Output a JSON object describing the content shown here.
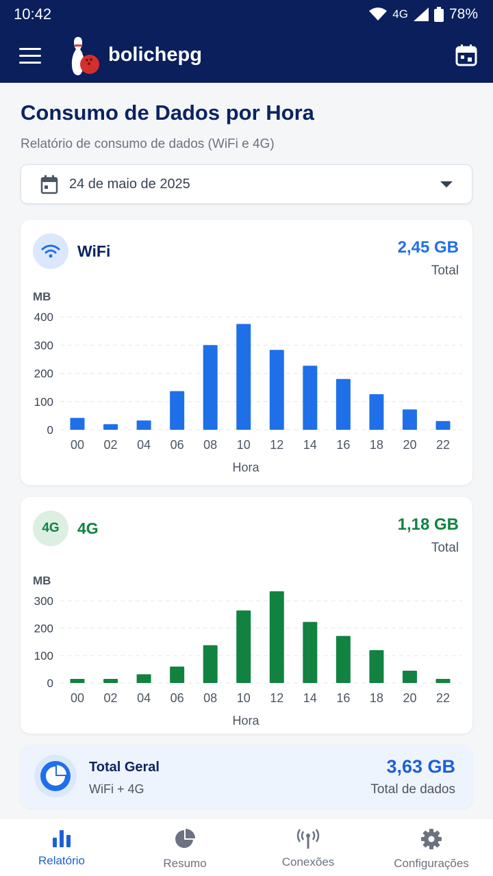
{
  "status_bar": {
    "time": "10:42",
    "network": "4G",
    "battery": "78%"
  },
  "app_bar": {
    "title": "bolichepg",
    "menu_icon": "menu-icon",
    "action_icon": "calendar-icon"
  },
  "page": {
    "title": "Consumo de Dados por Hora",
    "subtitle": "Relatório de consumo de dados (WiFi e 4G)",
    "date_select": {
      "value": "24 de maio de 2025",
      "icon": "calendar-icon"
    }
  },
  "wifi_card": {
    "name": "WiFi",
    "total": "2,45 GB",
    "total_label": "Total",
    "badge_icon": "wifi-icon",
    "color": "#1f6fe8"
  },
  "g4_card": {
    "name": "4G",
    "badge": "4G",
    "total": "1,18 GB",
    "total_label": "Total",
    "color": "#128241"
  },
  "summary": {
    "title": "Total Geral",
    "subtitle": "WiFi + 4G",
    "total": "3,63 GB",
    "total_label": "Total de dados",
    "icon": "pie-chart-icon"
  },
  "bottom_nav": [
    {
      "label": "Relatório",
      "icon": "bar-chart-icon",
      "active": true
    },
    {
      "label": "Resumo",
      "icon": "pie-chart-icon",
      "active": false
    },
    {
      "label": "Conexões",
      "icon": "antenna-icon",
      "active": false
    },
    {
      "label": "Configurações",
      "icon": "gear-icon",
      "active": false
    }
  ],
  "chart_data": [
    {
      "type": "bar",
      "title": "",
      "xlabel": "Hora",
      "ylabel": "MB",
      "categories": [
        "00",
        "02",
        "04",
        "06",
        "08",
        "10",
        "12",
        "14",
        "16",
        "18",
        "20",
        "22"
      ],
      "series": [
        {
          "name": "WiFi",
          "values": [
            42,
            20,
            33,
            137,
            300,
            375,
            283,
            227,
            180,
            126,
            72,
            31
          ]
        }
      ],
      "yticks": [
        0,
        100,
        200,
        300,
        400
      ],
      "ylim": [
        0,
        400
      ],
      "grid": true,
      "color": "#1f6fe8"
    },
    {
      "type": "bar",
      "title": "",
      "xlabel": "Hora",
      "ylabel": "MB",
      "categories": [
        "00",
        "02",
        "04",
        "06",
        "08",
        "10",
        "12",
        "14",
        "16",
        "18",
        "20",
        "22"
      ],
      "series": [
        {
          "name": "4G",
          "values": [
            15,
            15,
            32,
            60,
            138,
            265,
            335,
            223,
            172,
            120,
            45,
            15
          ]
        }
      ],
      "yticks": [
        0,
        100,
        200,
        300
      ],
      "ylim": [
        0,
        300
      ],
      "grid": true,
      "color": "#128241"
    }
  ]
}
